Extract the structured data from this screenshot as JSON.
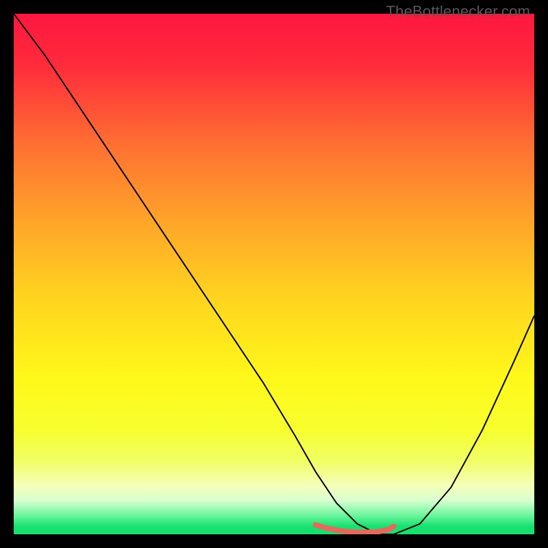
{
  "watermark": "TheBottlenecker.com",
  "chart_data": {
    "type": "line",
    "title": "",
    "xlabel": "",
    "ylabel": "",
    "xlim": [
      0,
      100
    ],
    "ylim": [
      0,
      100
    ],
    "grid": false,
    "legend": false,
    "background_gradient": {
      "stops": [
        {
          "pos": 0.0,
          "color": "#ff173f"
        },
        {
          "pos": 0.1,
          "color": "#ff2b3b"
        },
        {
          "pos": 0.25,
          "color": "#ff6f33"
        },
        {
          "pos": 0.4,
          "color": "#ffa529"
        },
        {
          "pos": 0.55,
          "color": "#ffd51f"
        },
        {
          "pos": 0.7,
          "color": "#fff81a"
        },
        {
          "pos": 0.8,
          "color": "#f7ff2e"
        },
        {
          "pos": 0.86,
          "color": "#f1ff66"
        },
        {
          "pos": 0.905,
          "color": "#f5ffb8"
        },
        {
          "pos": 0.935,
          "color": "#d9ffd0"
        },
        {
          "pos": 0.965,
          "color": "#66f59a"
        },
        {
          "pos": 0.985,
          "color": "#18e06f"
        },
        {
          "pos": 1.0,
          "color": "#18e06f"
        }
      ]
    },
    "series": [
      {
        "name": "bottleneck-curve",
        "color": "#000000",
        "width": 2,
        "x": [
          0,
          6,
          12,
          18,
          24,
          30,
          36,
          42,
          48,
          54,
          58,
          62,
          66,
          70,
          73,
          78,
          84,
          90,
          96,
          100
        ],
        "y": [
          100,
          92,
          83,
          74,
          65,
          56,
          47,
          38,
          29,
          19,
          12,
          6,
          2,
          0,
          0,
          2,
          9,
          20,
          33,
          42
        ]
      },
      {
        "name": "optimal-marker",
        "color": "#e46a5e",
        "width": 8,
        "cap": "round",
        "x": [
          58,
          60,
          62,
          64,
          66,
          68,
          70,
          72,
          73
        ],
        "y": [
          1.8,
          1.2,
          0.8,
          0.5,
          0.4,
          0.4,
          0.5,
          0.9,
          1.5
        ]
      }
    ]
  }
}
